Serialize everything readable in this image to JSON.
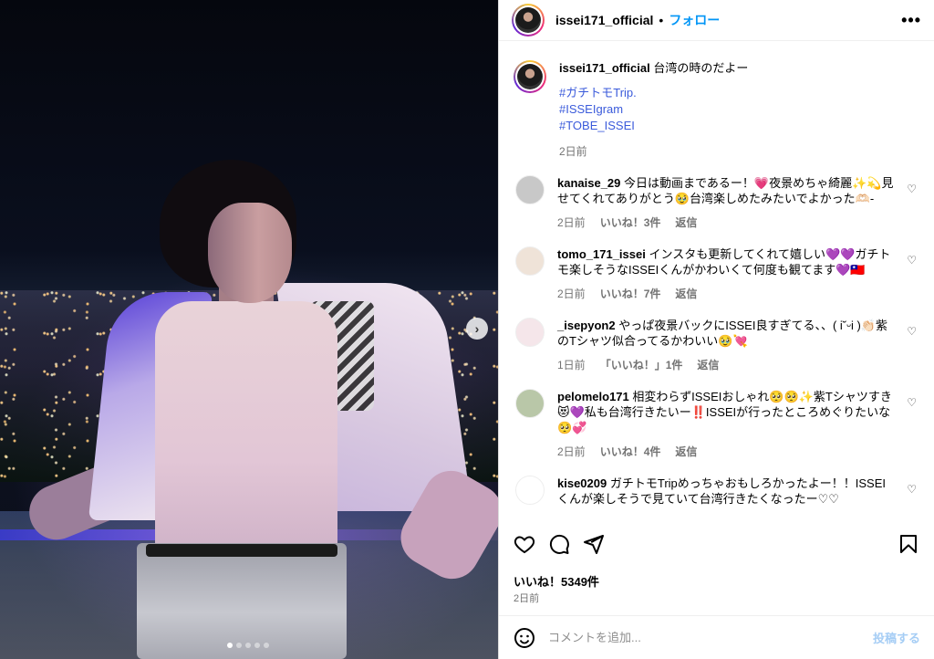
{
  "post": {
    "username": "issei171_official",
    "follow_label": "フォロー",
    "separator": "•",
    "more_label": "•••",
    "caption_text": "台湾の時のだよー",
    "hashtags": [
      "#ガチトモTrip.",
      "#ISSEIgram",
      "#TOBE_ISSEI"
    ],
    "caption_time": "2日前",
    "carousel_dots": 5,
    "carousel_active": 0,
    "next_label": "›"
  },
  "comments": [
    {
      "user": "kanaise_29",
      "text": "今日は動画まであるー！💗夜景めちゃ綺麗✨💫見せてくれてありがとう🥹台湾楽しめたみたいでよかった🫶🏻-",
      "time": "2日前",
      "likes": "いいね！3件",
      "reply": "返信",
      "avatar_color": "#c8c8c8"
    },
    {
      "user": "tomo_171_issei",
      "text": "インスタも更新してくれて嬉しい💜💜ガチトモ楽しそうなISSEIくんがかわいくて何度も観てます💜🇹🇼",
      "time": "2日前",
      "likes": "いいね！7件",
      "reply": "返信",
      "avatar_color": "#efe3d8"
    },
    {
      "user": "_isepyon2",
      "text": "やっぱ夜景バックにISSEI良すぎてる、、( i˘ᵕi )👏🏻紫のTシャツ似合ってるかわいい🥹💘",
      "time": "1日前",
      "likes": "「いいね！」1件",
      "reply": "返信",
      "avatar_color": "#f5e6ea"
    },
    {
      "user": "pelomelo171",
      "text": "相変わらずISSEIおしゃれ🥺🥺✨紫Tシャツすき😻💜私も台湾行きたいー‼️ISSEIが行ったところめぐりたいな🥺💞",
      "time": "2日前",
      "likes": "いいね！4件",
      "reply": "返信",
      "avatar_color": "#b9c7a8"
    },
    {
      "user": "kise0209",
      "text": "ガチトモTripめっちゃおもしろかったよー！！ISSEIくんが楽しそうで見ていて台湾行きたくなったー♡♡",
      "time": "",
      "likes": "",
      "reply": "",
      "avatar_color": "#ffffff"
    }
  ],
  "actions": {
    "like_icon": "heart-icon",
    "comment_icon": "comment-icon",
    "share_icon": "share-icon",
    "save_icon": "bookmark-icon"
  },
  "likes_total": "いいね！5349件",
  "post_date": "2日前",
  "add_comment": {
    "placeholder": "コメントを追加...",
    "post_label": "投稿する"
  },
  "colors": {
    "accent": "#0095f6",
    "hashtag": "#3b5bdb",
    "muted": "#737373"
  }
}
